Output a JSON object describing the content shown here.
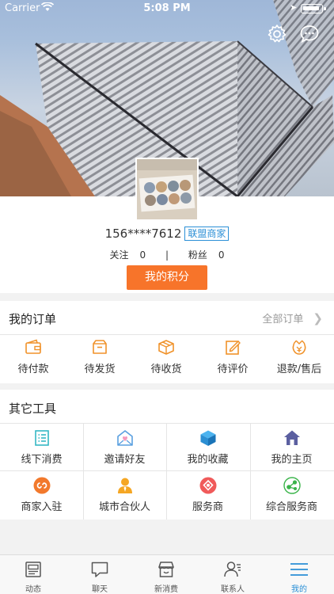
{
  "status_bar": {
    "carrier": "Carrier",
    "time": "5:08 PM"
  },
  "profile": {
    "phone": "156****7612",
    "badge": "联盟商家",
    "follow_label": "关注",
    "follow_count": "0",
    "separator": "|",
    "fans_label": "粉丝",
    "fans_count": "0",
    "points_button": "我的积分"
  },
  "orders": {
    "title": "我的订单",
    "all_label": "全部订单",
    "items": [
      {
        "label": "待付款",
        "icon": "wallet-icon"
      },
      {
        "label": "待发货",
        "icon": "package-icon"
      },
      {
        "label": "待收货",
        "icon": "box-icon"
      },
      {
        "label": "待评价",
        "icon": "edit-icon"
      },
      {
        "label": "退款/售后",
        "icon": "refund-icon"
      }
    ]
  },
  "tools": {
    "title": "其它工具",
    "items": [
      {
        "label": "线下消费",
        "icon": "list-icon"
      },
      {
        "label": "邀请好友",
        "icon": "invite-icon"
      },
      {
        "label": "我的收藏",
        "icon": "cube-icon"
      },
      {
        "label": "我的主页",
        "icon": "home-icon"
      },
      {
        "label": "商家入驻",
        "icon": "link-icon"
      },
      {
        "label": "城市合伙人",
        "icon": "partner-icon"
      },
      {
        "label": "服务商",
        "icon": "service-icon"
      },
      {
        "label": "综合服务商",
        "icon": "network-icon"
      }
    ]
  },
  "tabbar": {
    "items": [
      {
        "label": "动态",
        "icon": "news-icon"
      },
      {
        "label": "聊天",
        "icon": "chat-icon"
      },
      {
        "label": "新消费",
        "icon": "shop-icon"
      },
      {
        "label": "联系人",
        "icon": "contacts-icon"
      },
      {
        "label": "我的",
        "icon": "menu-icon"
      }
    ],
    "active_index": 4
  },
  "colors": {
    "accent": "#2a8fd6",
    "orange": "#f7742a",
    "order_icon": "#f0922a"
  }
}
